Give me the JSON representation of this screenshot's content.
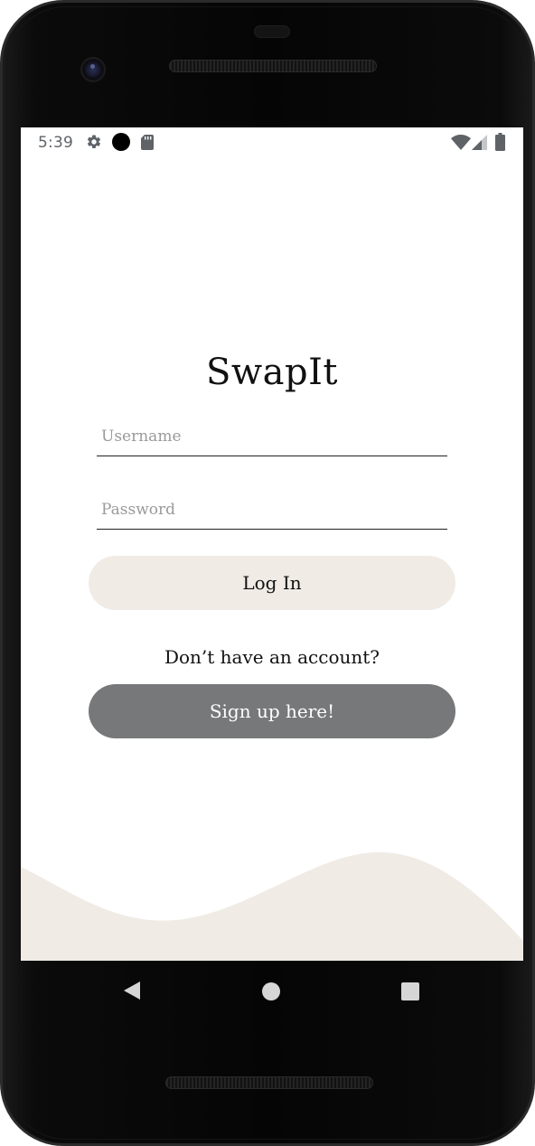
{
  "status_bar": {
    "time": "5:39",
    "icons": [
      "gear-icon",
      "dot-icon",
      "sd-card-icon",
      "wifi-icon",
      "signal-icon",
      "battery-icon"
    ]
  },
  "app": {
    "title": "SwapIt"
  },
  "login_form": {
    "username_placeholder": "Username",
    "username_value": "",
    "password_placeholder": "Password",
    "password_value": "",
    "login_label": "Log In"
  },
  "signup": {
    "prompt": "Don’t have an account?",
    "button_label": "Sign up here!"
  },
  "nav_bar": {
    "icons": [
      "back-icon",
      "home-icon",
      "recents-icon"
    ]
  },
  "colors": {
    "screen_bg": "#ffffff",
    "accent_beige": "#f0ebe5",
    "signup_gray": "#77787a",
    "text_dark": "#111111",
    "placeholder_gray": "#9a9a9a",
    "status_gray": "#5f6368",
    "device_black": "#050505"
  }
}
